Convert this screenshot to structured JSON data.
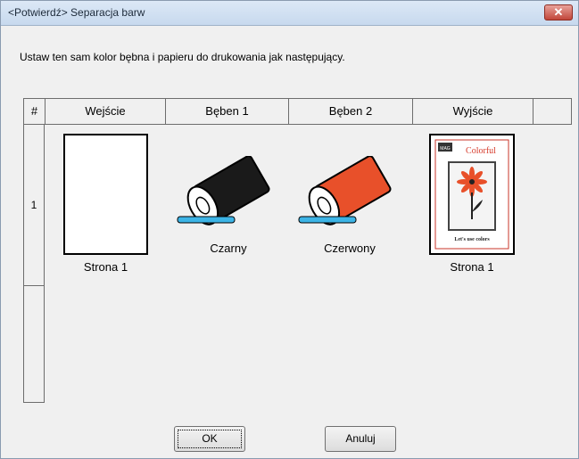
{
  "window": {
    "title": "<Potwierdź> Separacja barw",
    "close_label": "✕"
  },
  "instruction": "Ustaw ten sam kolor bębna i papieru do drukowania jak następujący.",
  "table": {
    "headers": [
      "#",
      "Wejście",
      "Bęben 1",
      "Bęben 2",
      "Wyjście",
      ""
    ],
    "rows": [
      "1",
      ""
    ]
  },
  "items": {
    "input_caption": "Strona 1",
    "drum1_caption": "Czarny",
    "drum2_caption": "Czerwony",
    "output_caption": "Strona 1",
    "drum1_color": "#1a1a1a",
    "drum2_color": "#e8502a",
    "output_image": {
      "brand": "Colorful",
      "tagline": "Let's use colors",
      "corner": "MAG"
    }
  },
  "buttons": {
    "ok": "OK",
    "cancel": "Anuluj"
  }
}
